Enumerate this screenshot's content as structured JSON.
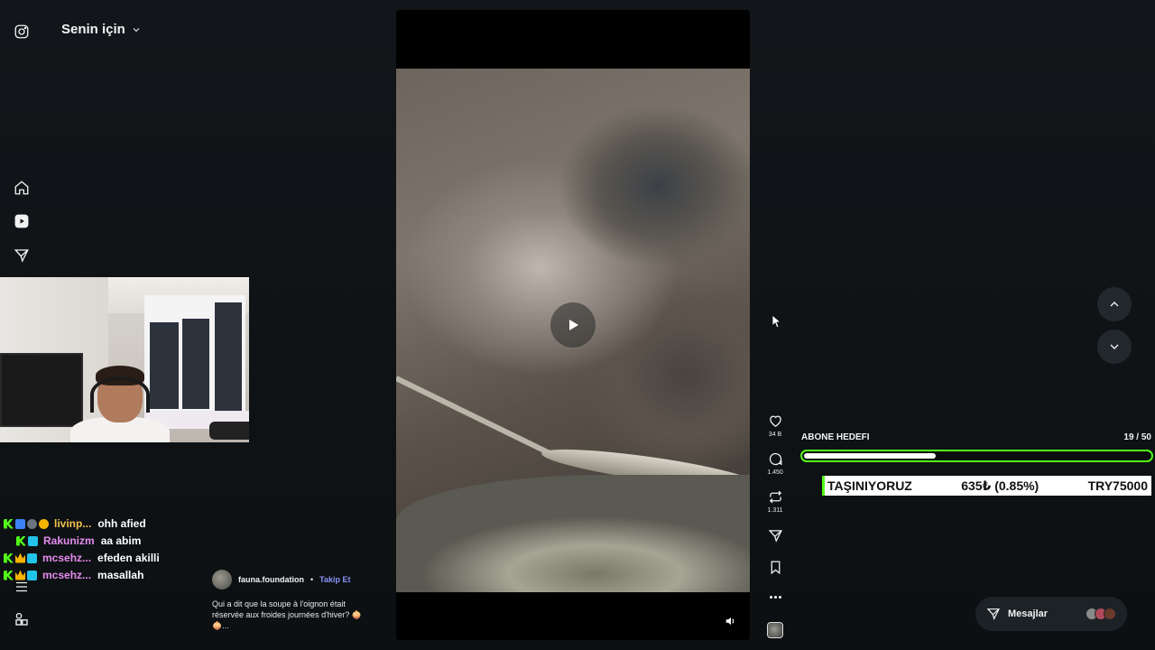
{
  "header": {
    "feed_title": "Senin için"
  },
  "nav": {
    "icons": [
      "instagram-icon",
      "home-icon",
      "reels-icon",
      "send-icon",
      "menu-icon",
      "more-icon"
    ]
  },
  "chat": [
    {
      "user": "livinp...",
      "message": "ohh afied",
      "user_color": "#f2c14e"
    },
    {
      "user": "Rakunizm",
      "message": "aa abim",
      "user_color": "#e58cf0"
    },
    {
      "user": "mcsehz...",
      "message": "efeden akilli",
      "user_color": "#e58cf0"
    },
    {
      "user": "mcsehz...",
      "message": "masallah",
      "user_color": "#e58cf0"
    }
  ],
  "post": {
    "author": "fauna.foundation",
    "separator": "•",
    "follow_label": "Takip Et",
    "caption": "Qui a dit que la soupe à l'oignon était réservée aux froides journées d'hiver? 🧅🧅...",
    "likes": "34 B",
    "comments": "1.450",
    "reposts": "1.311"
  },
  "goal": {
    "label": "ABONE HEDEFI",
    "count": "19 / 50",
    "progress": 0.38
  },
  "ticker": {
    "left": "TAŞINIYORUZ",
    "middle": "635₺ (0.85%)",
    "right": "TRY75000"
  },
  "messages": {
    "label": "Mesajlar"
  },
  "colors": {
    "accent_green": "#53fc18",
    "follow_purple": "#8b93f8"
  }
}
